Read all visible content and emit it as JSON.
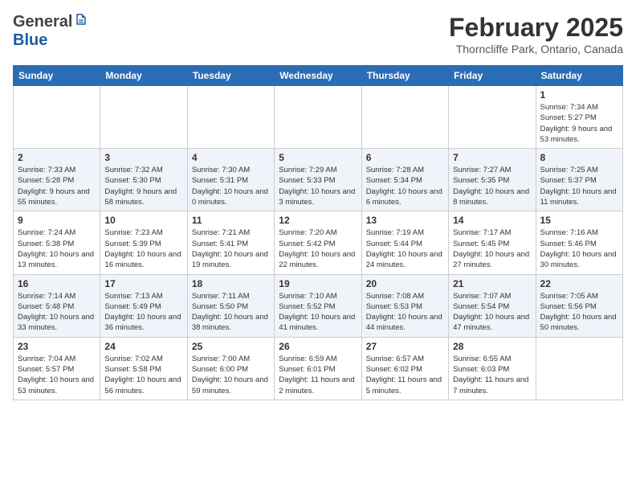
{
  "header": {
    "logo_general": "General",
    "logo_blue": "Blue",
    "month_title": "February 2025",
    "location": "Thorncliffe Park, Ontario, Canada"
  },
  "weekdays": [
    "Sunday",
    "Monday",
    "Tuesday",
    "Wednesday",
    "Thursday",
    "Friday",
    "Saturday"
  ],
  "weeks": [
    [
      {
        "day": "",
        "info": ""
      },
      {
        "day": "",
        "info": ""
      },
      {
        "day": "",
        "info": ""
      },
      {
        "day": "",
        "info": ""
      },
      {
        "day": "",
        "info": ""
      },
      {
        "day": "",
        "info": ""
      },
      {
        "day": "1",
        "info": "Sunrise: 7:34 AM\nSunset: 5:27 PM\nDaylight: 9 hours and 53 minutes."
      }
    ],
    [
      {
        "day": "2",
        "info": "Sunrise: 7:33 AM\nSunset: 5:28 PM\nDaylight: 9 hours and 55 minutes."
      },
      {
        "day": "3",
        "info": "Sunrise: 7:32 AM\nSunset: 5:30 PM\nDaylight: 9 hours and 58 minutes."
      },
      {
        "day": "4",
        "info": "Sunrise: 7:30 AM\nSunset: 5:31 PM\nDaylight: 10 hours and 0 minutes."
      },
      {
        "day": "5",
        "info": "Sunrise: 7:29 AM\nSunset: 5:33 PM\nDaylight: 10 hours and 3 minutes."
      },
      {
        "day": "6",
        "info": "Sunrise: 7:28 AM\nSunset: 5:34 PM\nDaylight: 10 hours and 6 minutes."
      },
      {
        "day": "7",
        "info": "Sunrise: 7:27 AM\nSunset: 5:35 PM\nDaylight: 10 hours and 8 minutes."
      },
      {
        "day": "8",
        "info": "Sunrise: 7:25 AM\nSunset: 5:37 PM\nDaylight: 10 hours and 11 minutes."
      }
    ],
    [
      {
        "day": "9",
        "info": "Sunrise: 7:24 AM\nSunset: 5:38 PM\nDaylight: 10 hours and 13 minutes."
      },
      {
        "day": "10",
        "info": "Sunrise: 7:23 AM\nSunset: 5:39 PM\nDaylight: 10 hours and 16 minutes."
      },
      {
        "day": "11",
        "info": "Sunrise: 7:21 AM\nSunset: 5:41 PM\nDaylight: 10 hours and 19 minutes."
      },
      {
        "day": "12",
        "info": "Sunrise: 7:20 AM\nSunset: 5:42 PM\nDaylight: 10 hours and 22 minutes."
      },
      {
        "day": "13",
        "info": "Sunrise: 7:19 AM\nSunset: 5:44 PM\nDaylight: 10 hours and 24 minutes."
      },
      {
        "day": "14",
        "info": "Sunrise: 7:17 AM\nSunset: 5:45 PM\nDaylight: 10 hours and 27 minutes."
      },
      {
        "day": "15",
        "info": "Sunrise: 7:16 AM\nSunset: 5:46 PM\nDaylight: 10 hours and 30 minutes."
      }
    ],
    [
      {
        "day": "16",
        "info": "Sunrise: 7:14 AM\nSunset: 5:48 PM\nDaylight: 10 hours and 33 minutes."
      },
      {
        "day": "17",
        "info": "Sunrise: 7:13 AM\nSunset: 5:49 PM\nDaylight: 10 hours and 36 minutes."
      },
      {
        "day": "18",
        "info": "Sunrise: 7:11 AM\nSunset: 5:50 PM\nDaylight: 10 hours and 38 minutes."
      },
      {
        "day": "19",
        "info": "Sunrise: 7:10 AM\nSunset: 5:52 PM\nDaylight: 10 hours and 41 minutes."
      },
      {
        "day": "20",
        "info": "Sunrise: 7:08 AM\nSunset: 5:53 PM\nDaylight: 10 hours and 44 minutes."
      },
      {
        "day": "21",
        "info": "Sunrise: 7:07 AM\nSunset: 5:54 PM\nDaylight: 10 hours and 47 minutes."
      },
      {
        "day": "22",
        "info": "Sunrise: 7:05 AM\nSunset: 5:56 PM\nDaylight: 10 hours and 50 minutes."
      }
    ],
    [
      {
        "day": "23",
        "info": "Sunrise: 7:04 AM\nSunset: 5:57 PM\nDaylight: 10 hours and 53 minutes."
      },
      {
        "day": "24",
        "info": "Sunrise: 7:02 AM\nSunset: 5:58 PM\nDaylight: 10 hours and 56 minutes."
      },
      {
        "day": "25",
        "info": "Sunrise: 7:00 AM\nSunset: 6:00 PM\nDaylight: 10 hours and 59 minutes."
      },
      {
        "day": "26",
        "info": "Sunrise: 6:59 AM\nSunset: 6:01 PM\nDaylight: 11 hours and 2 minutes."
      },
      {
        "day": "27",
        "info": "Sunrise: 6:57 AM\nSunset: 6:02 PM\nDaylight: 11 hours and 5 minutes."
      },
      {
        "day": "28",
        "info": "Sunrise: 6:55 AM\nSunset: 6:03 PM\nDaylight: 11 hours and 7 minutes."
      },
      {
        "day": "",
        "info": ""
      }
    ]
  ]
}
